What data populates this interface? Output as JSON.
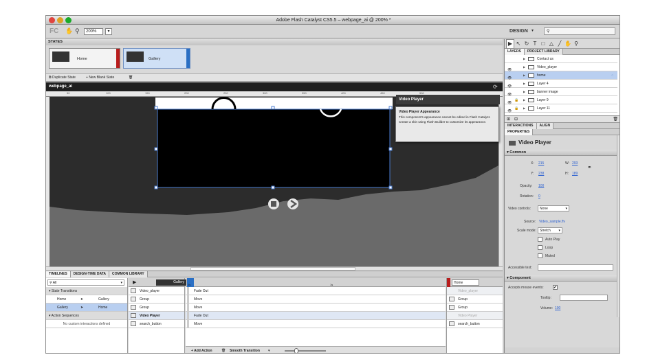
{
  "window": {
    "title": "Adobe Flash Catalyst CS5.5 – webpage_ai @ 200% *"
  },
  "appbar": {
    "logo": "FC",
    "zoom": "200%",
    "workspace": "DESIGN"
  },
  "states": {
    "header": "STATES",
    "tiles": [
      {
        "label": "Home"
      },
      {
        "label": "Gallery"
      }
    ],
    "duplicate": "Duplicate State",
    "new_blank": "New Blank State"
  },
  "stage": {
    "title": "webpage_ai",
    "ruler": [
      "50",
      "100",
      "150",
      "200",
      "250",
      "300",
      "350",
      "400",
      "450",
      "500"
    ]
  },
  "tooltip": {
    "title": "Video Player",
    "heading": "Video Player Appearance",
    "body": "This component's appearance cannot be edited in Flash Catalyst. Create a skin using Flash Builder to customize its appearance."
  },
  "tools": [
    "▶",
    "↖",
    "↻",
    "T",
    "□",
    "△",
    "╱",
    "✋",
    "⚲"
  ],
  "layers": {
    "tabs": [
      "LAYERS",
      "PROJECT LIBRARY"
    ],
    "items": [
      "Contact us",
      "Video_player",
      "home",
      "Layer 4",
      "banner image",
      "Layer 9",
      "Layer 11"
    ]
  },
  "right_tabs": [
    "INTERACTIONS",
    "ALIGN"
  ],
  "properties": {
    "tab": "PROPERTIES",
    "name": "Video Player",
    "common": "Common",
    "x_label": "X:",
    "x": "215",
    "w_label": "W:",
    "w": "293",
    "y_label": "Y:",
    "y": "238",
    "h_label": "H:",
    "h": "189",
    "opacity_label": "Opacity:",
    "opacity": "100",
    "rotation_label": "Rotation:",
    "rotation": "0",
    "vc_label": "Video controls:",
    "vc": "None",
    "source_label": "Source:",
    "source": "Video_sample.flv",
    "scale_label": "Scale mode:",
    "scale": "Stretch",
    "autoplay": "Auto Play",
    "loop": "Loop",
    "muted": "Muted",
    "accessible_label": "Accessible text:",
    "component": "Component",
    "mouse_label": "Accepts mouse events:",
    "tooltip_label": "Tooltip:",
    "volume_label": "Volume:",
    "volume": "100"
  },
  "timelines": {
    "tabs": [
      "TIMELINES",
      "DESIGN-TIME DATA",
      "COMMON LIBRARY"
    ],
    "filter": "All",
    "state_transitions": "State Transitions",
    "transitions": [
      {
        "from": "Home",
        "to": "Gallery"
      },
      {
        "from": "Gallery",
        "to": "Home"
      }
    ],
    "action_sequences": "Action Sequences",
    "no_custom": "No custom interactions defined",
    "source_state": "Gallery",
    "target_state": "Home",
    "ruler_start": "0s",
    "ruler_mid": "1s",
    "objects": [
      "Video_player",
      "Group",
      "Group",
      "Video Player",
      "search_button"
    ],
    "actions": [
      "Fade Out",
      "Move",
      "Move",
      "Fade Out",
      "Move"
    ],
    "targets": [
      "Video_player",
      "Group",
      "Group",
      "Video Player",
      "search_button"
    ],
    "add_action": "Add Action",
    "smooth": "Smooth Transition"
  }
}
